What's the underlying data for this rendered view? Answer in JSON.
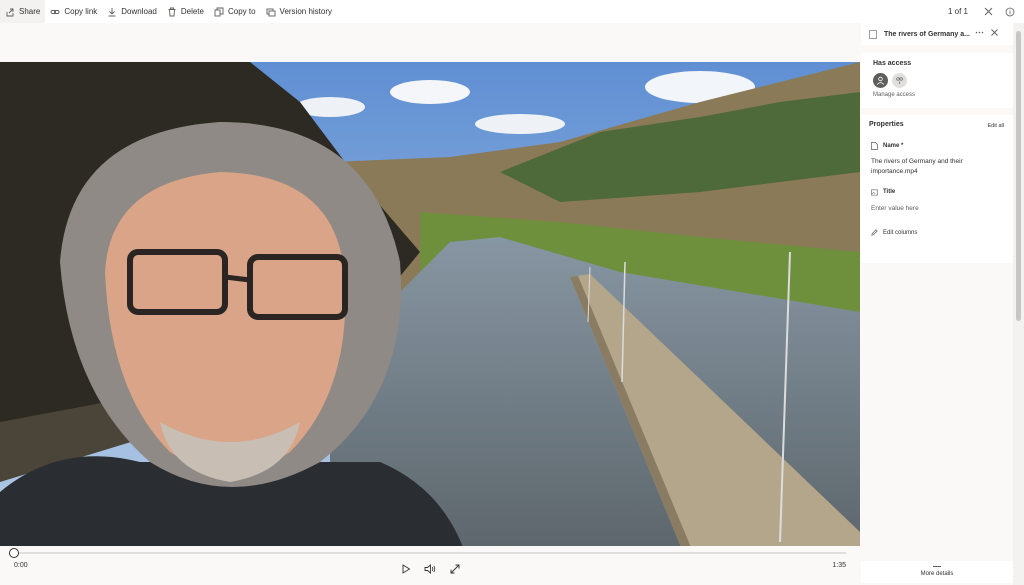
{
  "toolbar": {
    "share": "Share",
    "copy_link": "Copy link",
    "download": "Download",
    "delete": "Delete",
    "copy_to": "Copy to",
    "version_history": "Version history",
    "page_count": "1 of 1"
  },
  "player": {
    "current_time": "0:00",
    "duration": "1:35",
    "progress_fraction": 0.0
  },
  "panel": {
    "file_title": "The rivers of Germany and their importance.mp4",
    "file_title_short": "The rivers of Germany a...",
    "has_access_heading": "Has access",
    "manage_access": "Manage access",
    "properties_heading": "Properties",
    "edit_all": "Edit all",
    "name_label": "Name *",
    "name_value": "The rivers of Germany and their importance.mp4",
    "title_label": "Title",
    "title_placeholder": "Enter value here",
    "edit_columns": "Edit columns",
    "more_details": "More details"
  },
  "icons": [
    "share-icon",
    "link-icon",
    "download-icon",
    "trash-icon",
    "copy-icon",
    "history-icon",
    "close-icon",
    "info-icon",
    "play-icon",
    "volume-icon",
    "fullscreen-icon",
    "document-icon",
    "image-icon",
    "pencil-icon"
  ],
  "colors": {
    "accent": "#0078d4",
    "toolbar_bg": "#ffffff",
    "page_bg": "#faf9f8"
  }
}
